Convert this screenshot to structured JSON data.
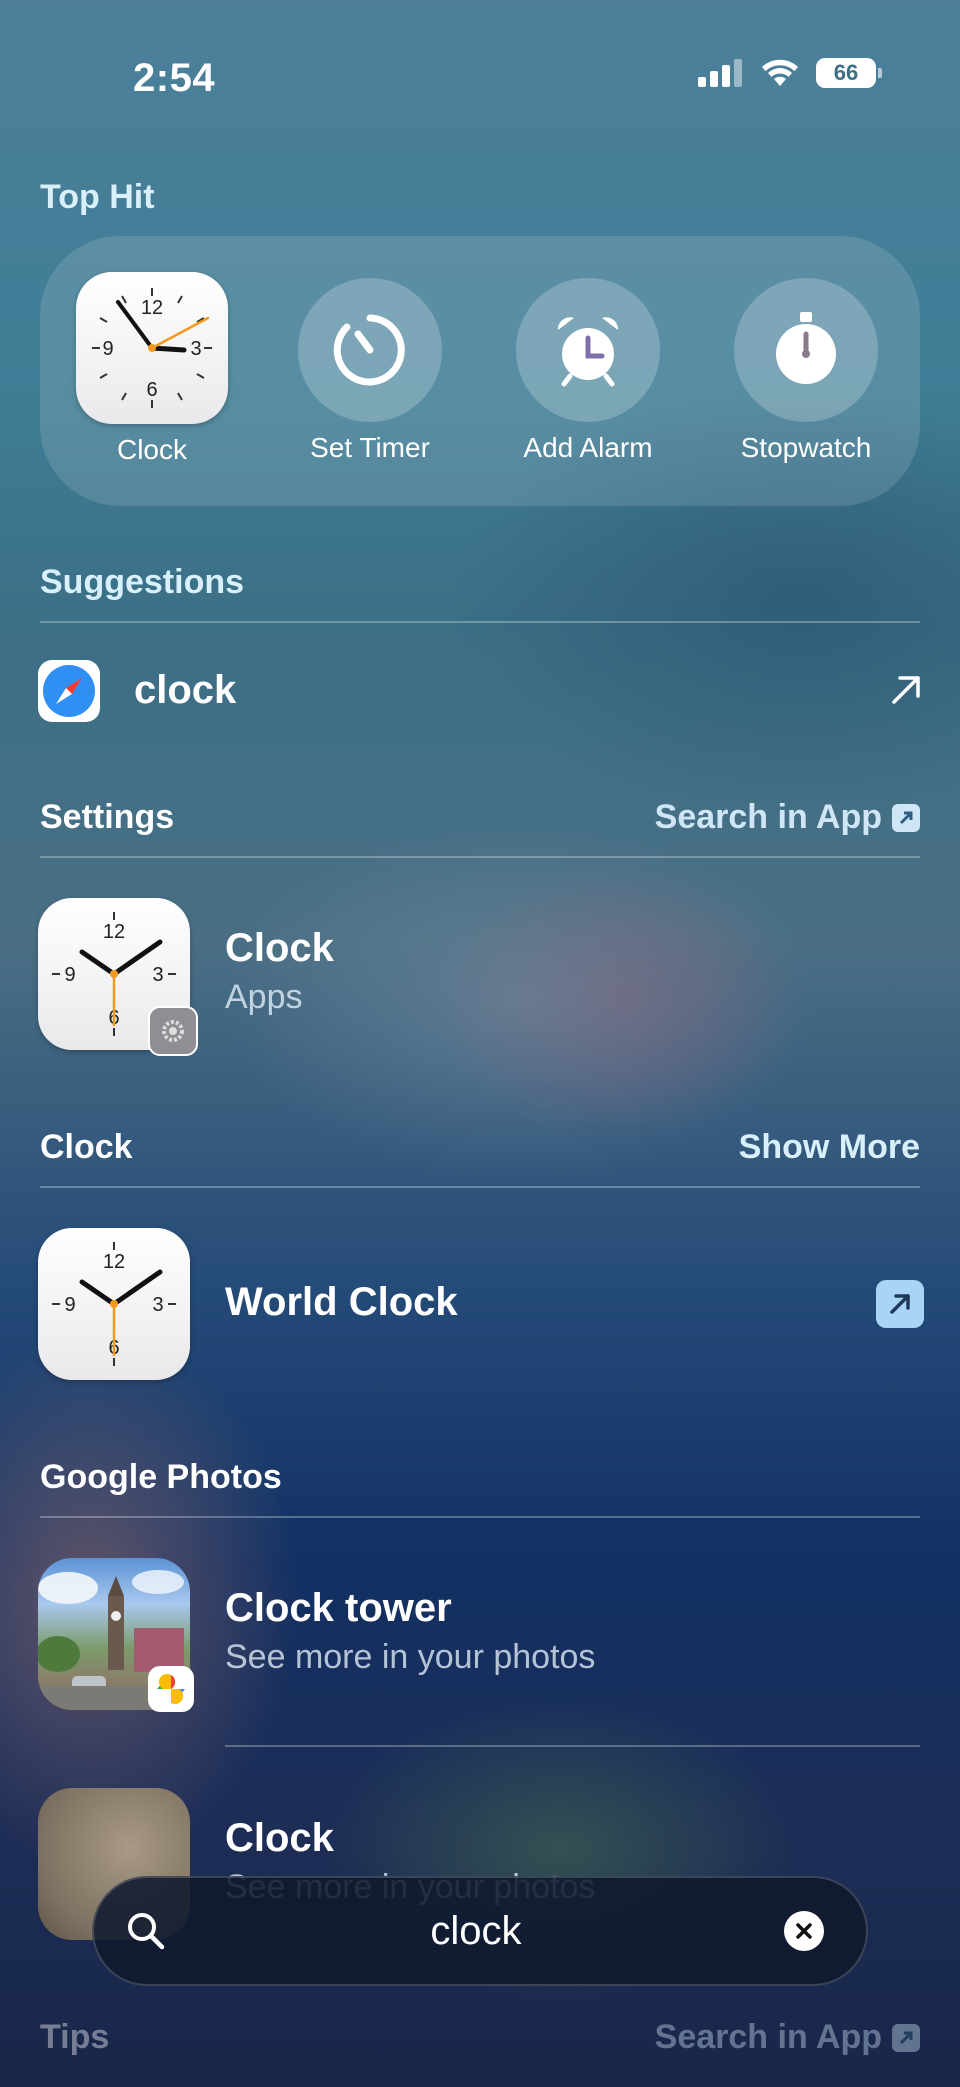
{
  "status": {
    "time": "2:54",
    "battery": "66"
  },
  "top_hit": {
    "title": "Top Hit",
    "items": [
      {
        "label": "Clock",
        "icon": "clock-app-icon"
      },
      {
        "label": "Set Timer",
        "icon": "timer-icon"
      },
      {
        "label": "Add Alarm",
        "icon": "alarm-clock-icon"
      },
      {
        "label": "Stopwatch",
        "icon": "stopwatch-icon"
      }
    ]
  },
  "suggestions": {
    "title": "Suggestions",
    "items": [
      {
        "text": "clock",
        "icon": "safari-icon"
      }
    ]
  },
  "settings": {
    "title": "Settings",
    "action": "Search in App",
    "items": [
      {
        "title": "Clock",
        "subtitle": "Apps"
      }
    ]
  },
  "clock_section": {
    "title": "Clock",
    "action": "Show More",
    "items": [
      {
        "title": "World Clock"
      }
    ]
  },
  "google_photos": {
    "title": "Google Photos",
    "items": [
      {
        "title": "Clock tower",
        "subtitle": "See more in your photos"
      },
      {
        "title": "Clock",
        "subtitle": "See more in your photos"
      }
    ]
  },
  "tips": {
    "title": "Tips",
    "action": "Search in App"
  },
  "search": {
    "query": "clock"
  }
}
